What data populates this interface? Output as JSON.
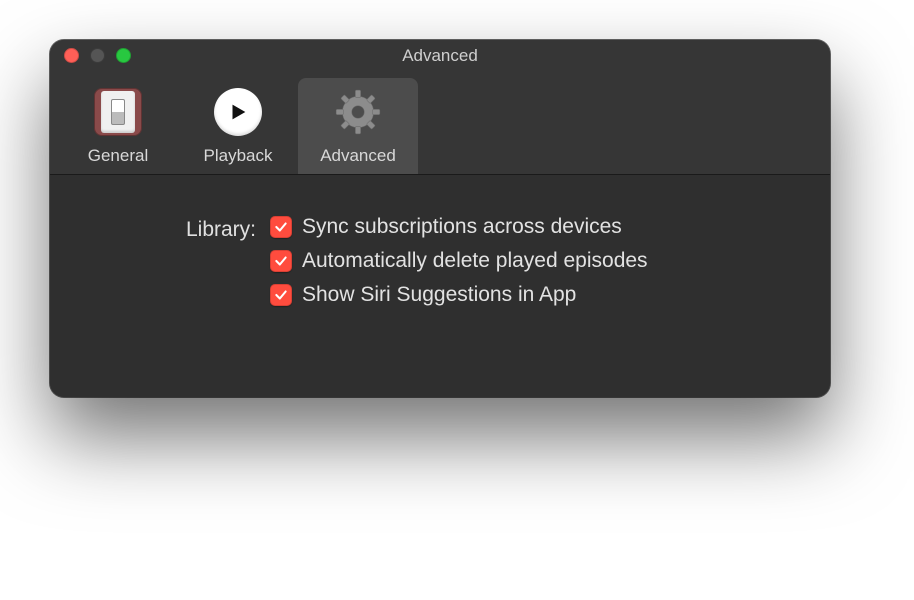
{
  "window": {
    "title": "Advanced"
  },
  "tabs": {
    "general": {
      "label": "General"
    },
    "playback": {
      "label": "Playback"
    },
    "advanced": {
      "label": "Advanced"
    }
  },
  "section": {
    "library_label": "Library:"
  },
  "options": {
    "sync": {
      "label": "Sync subscriptions across devices",
      "checked": true
    },
    "auto": {
      "label": "Automatically delete played episodes",
      "checked": true
    },
    "siri": {
      "label": "Show Siri Suggestions in App",
      "checked": true
    }
  }
}
